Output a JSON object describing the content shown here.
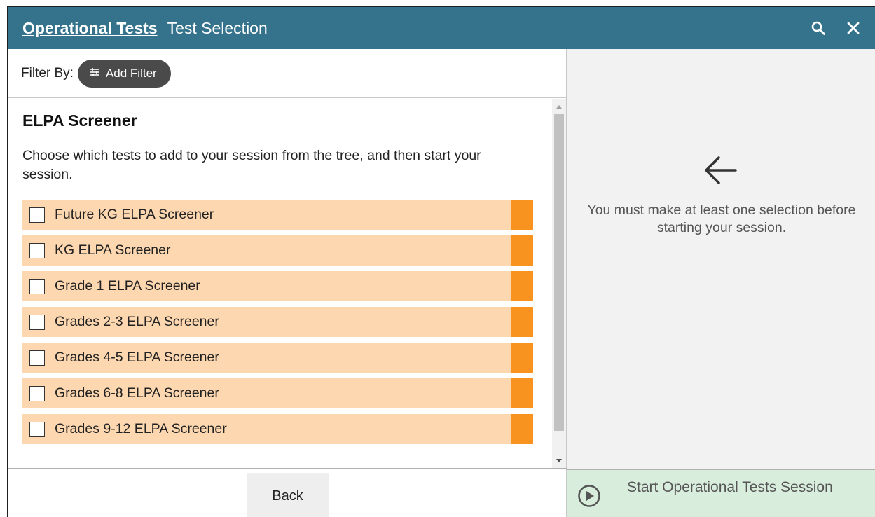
{
  "header": {
    "link_label": "Operational Tests",
    "subtitle": "Test Selection",
    "icons": [
      "search-icon",
      "close-icon"
    ],
    "color": "#35738d"
  },
  "filter": {
    "label": "Filter By:",
    "button_label": "Add Filter",
    "button_icon": "sliders-icon"
  },
  "main": {
    "heading": "ELPA Screener",
    "instructions": "Choose which tests to add to your session from the tree, and then start your session.",
    "tests": [
      {
        "label": "Future KG ELPA Screener",
        "checked": false
      },
      {
        "label": "KG ELPA Screener",
        "checked": false
      },
      {
        "label": "Grade 1 ELPA Screener",
        "checked": false
      },
      {
        "label": "Grades 2-3 ELPA Screener",
        "checked": false
      },
      {
        "label": "Grades 4-5 ELPA Screener",
        "checked": false
      },
      {
        "label": "Grades 6-8 ELPA Screener",
        "checked": false
      },
      {
        "label": "Grades 9-12 ELPA Screener",
        "checked": false
      }
    ],
    "row_color": "#fdd7b0",
    "tag_color": "#f7931e"
  },
  "footer": {
    "back_label": "Back",
    "start_label": "Start Operational Tests Session",
    "start_icon": "play-circle-icon"
  },
  "side": {
    "icon": "arrow-left-icon",
    "message": "You must make at least one selection before starting your session."
  }
}
